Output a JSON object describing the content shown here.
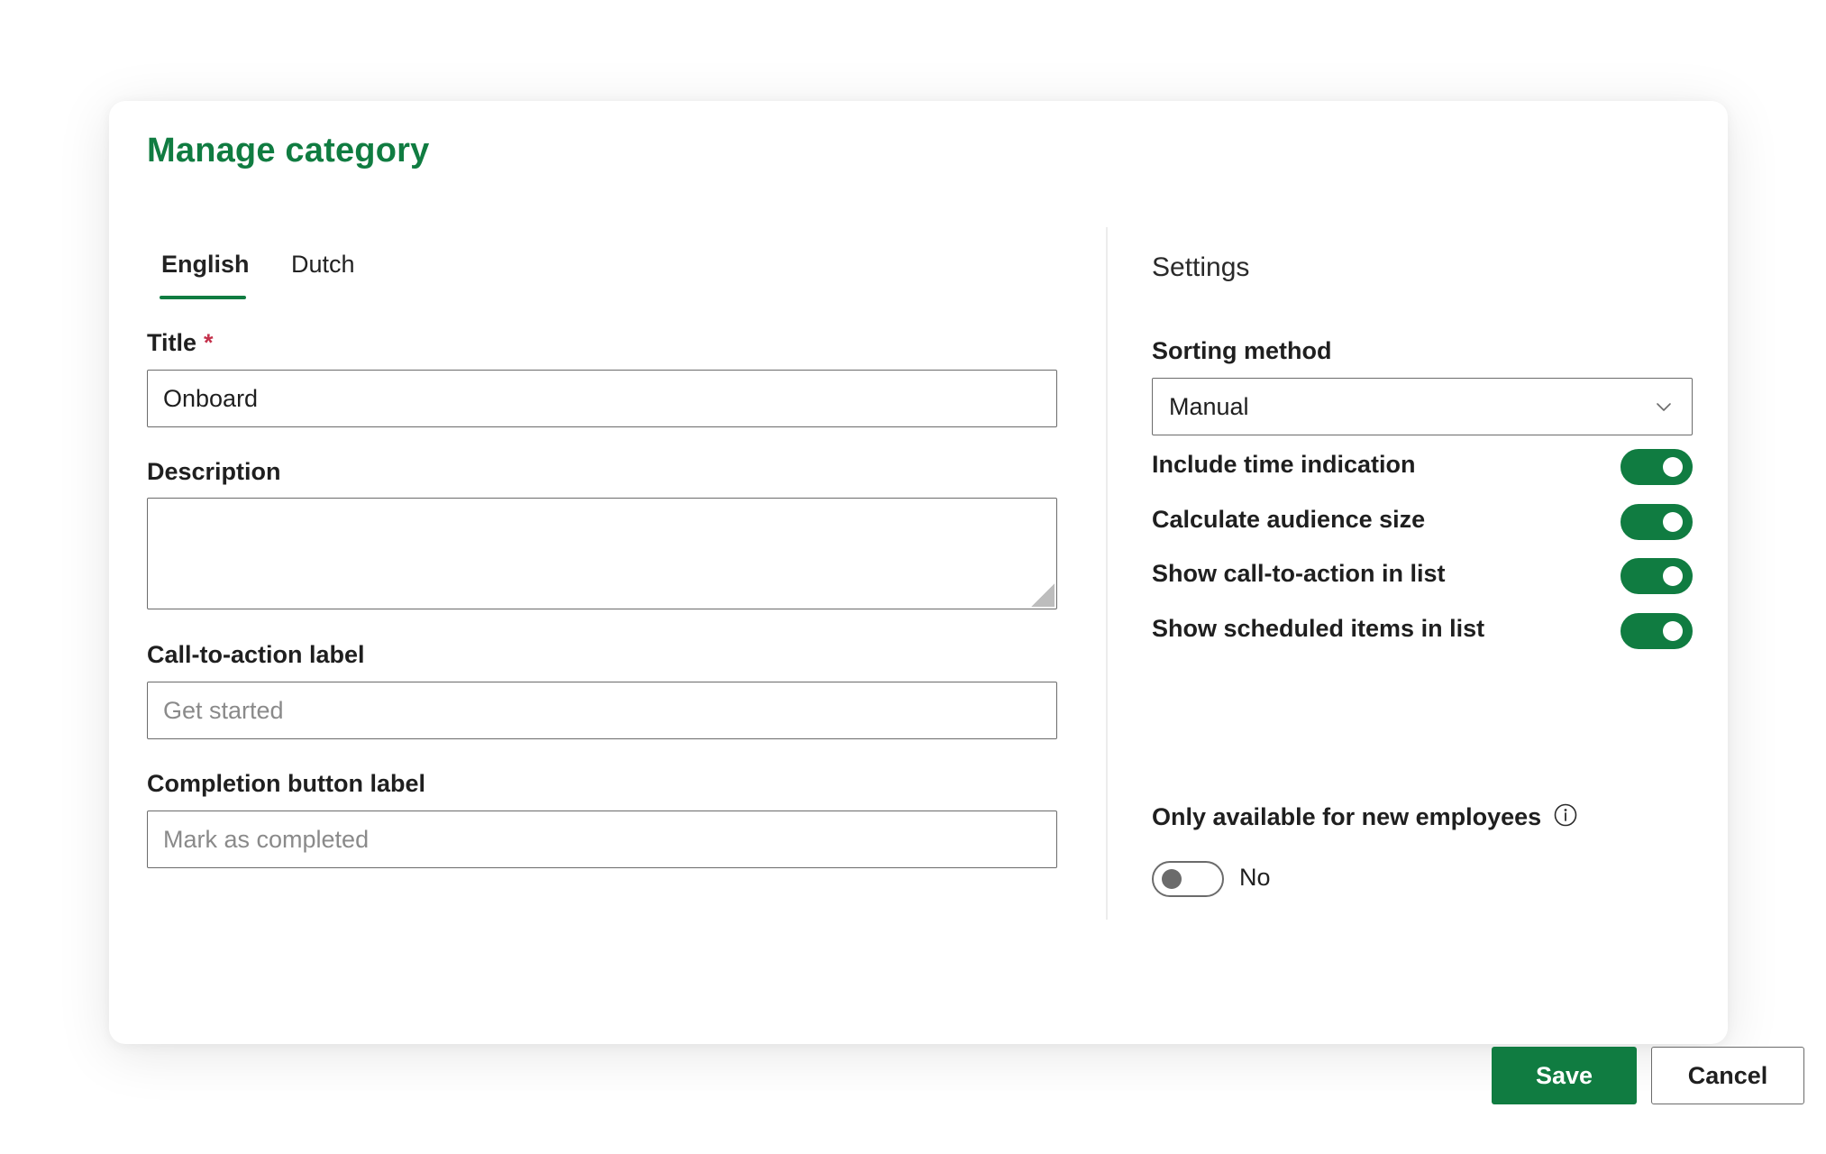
{
  "dialog": {
    "title": "Manage category"
  },
  "tabs": [
    {
      "label": "English",
      "active": true
    },
    {
      "label": "Dutch",
      "active": false
    }
  ],
  "fields": {
    "title": {
      "label": "Title",
      "required_mark": "*",
      "value": "Onboard"
    },
    "description": {
      "label": "Description",
      "value": ""
    },
    "cta_label": {
      "label": "Call-to-action label",
      "placeholder": "Get started"
    },
    "completion_label": {
      "label": "Completion button label",
      "placeholder": "Mark as completed"
    }
  },
  "settings": {
    "title": "Settings",
    "sorting_method": {
      "label": "Sorting method",
      "value": "Manual"
    },
    "toggles": [
      {
        "label": "Include time indication",
        "on": true
      },
      {
        "label": "Calculate audience size",
        "on": true
      },
      {
        "label": "Show call-to-action in list",
        "on": true
      },
      {
        "label": "Show scheduled items in list",
        "on": true
      }
    ],
    "only_new_employees": {
      "label": "Only available for new employees",
      "on": false,
      "state_text": "No"
    }
  },
  "buttons": {
    "save": "Save",
    "cancel": "Cancel"
  },
  "colors": {
    "accent": "#107c41",
    "highlight": "#fbb125",
    "required": "#c4314b"
  },
  "icons": [
    "chevron-down-icon",
    "info-icon"
  ]
}
